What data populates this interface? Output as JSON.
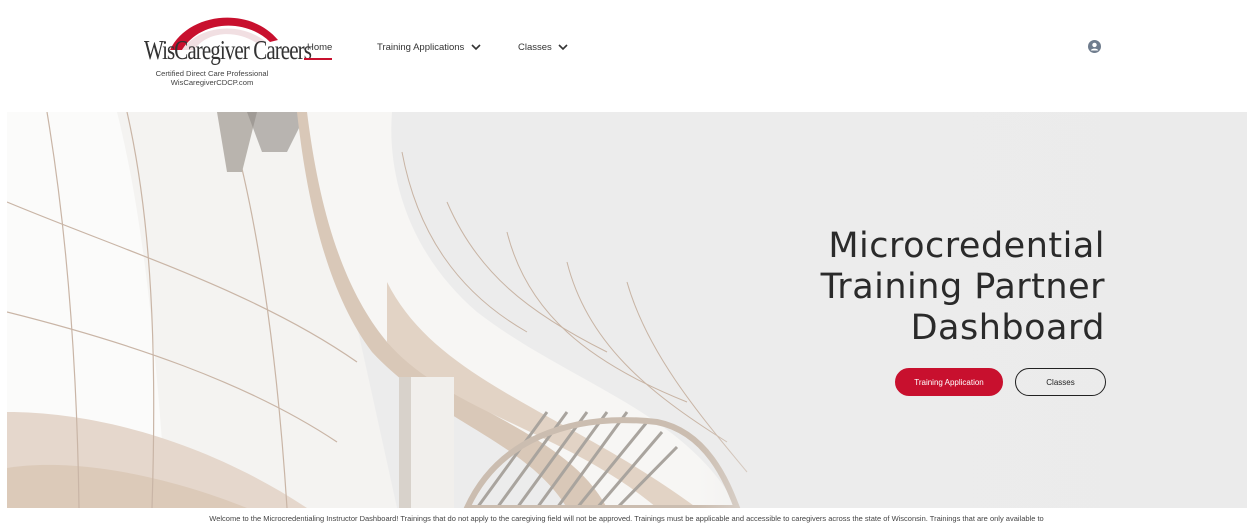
{
  "brand": {
    "logo_name": "WisCaregiver Careers",
    "logo_line1": "Certified Direct Care Professional",
    "logo_line2": "WisCaregiverCDCP.com",
    "accent_color": "#c8102e"
  },
  "nav": {
    "items": [
      {
        "label": "Home",
        "active": true
      },
      {
        "label": "Training Applications",
        "icon": "chevron-down-icon"
      },
      {
        "label": "Classes",
        "icon": "chevron-down-icon"
      }
    ],
    "user_icon": "user-avatar-icon"
  },
  "hero": {
    "title_lines": [
      "Microcredential",
      "Training Partner",
      "Dashboard"
    ],
    "primary_button": "Training Application",
    "secondary_button": "Classes"
  },
  "welcome": {
    "text": "Welcome to the Microcredentialing Instructor Dashboard! Trainings that do not apply to the caregiving field will not be approved. Trainings must be applicable and accessible to caregivers across the state of Wisconsin. Trainings that are only available to"
  }
}
